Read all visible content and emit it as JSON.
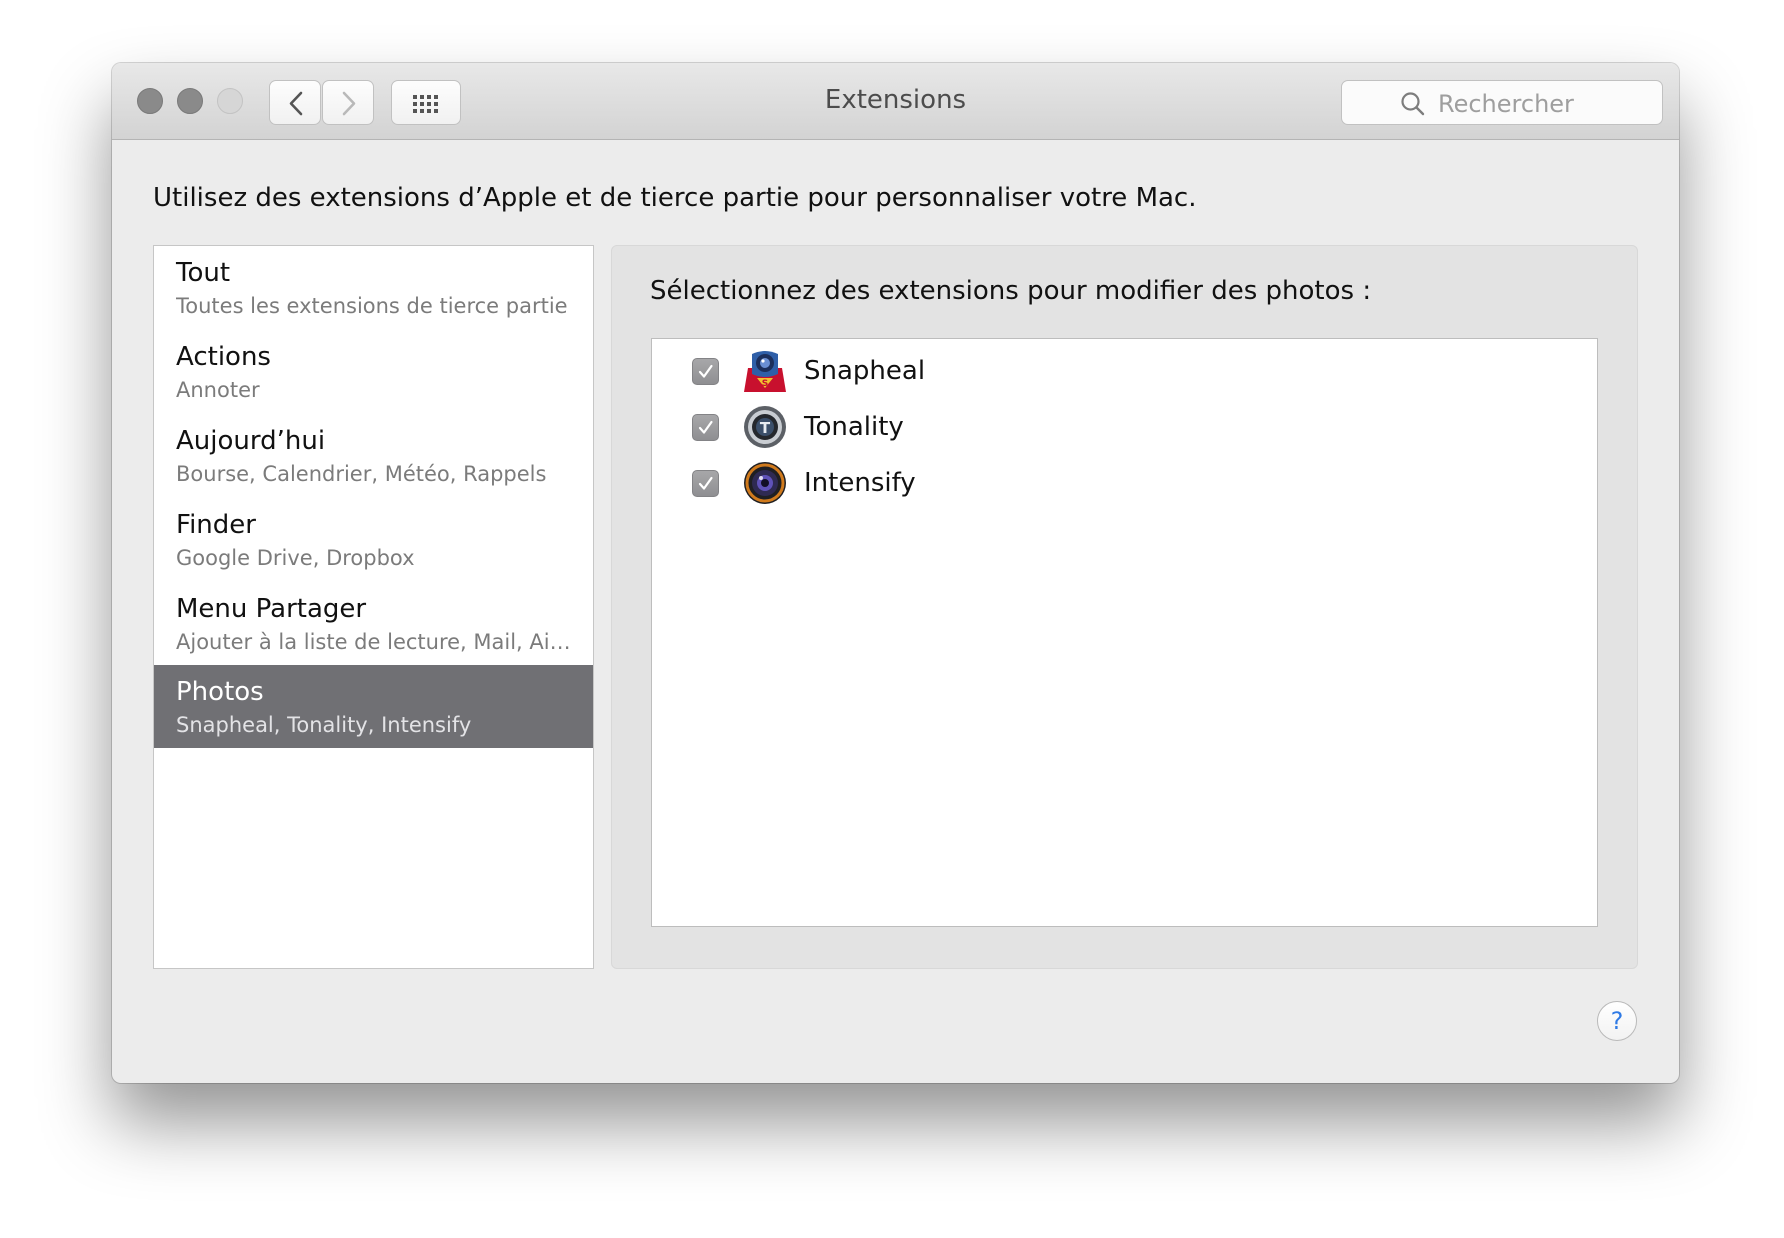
{
  "window": {
    "title": "Extensions",
    "search_placeholder": "Rechercher",
    "nav": {
      "back_icon": "chevron-left-icon",
      "forward_icon": "chevron-right-icon",
      "grid_icon": "grid-icon"
    }
  },
  "intro_text": "Utilisez des extensions d’Apple et de tierce partie pour personnaliser votre Mac.",
  "sidebar": {
    "items": [
      {
        "name": "Tout",
        "description": "Toutes les extensions de tierce partie",
        "selected": false
      },
      {
        "name": "Actions",
        "description": "Annoter",
        "selected": false
      },
      {
        "name": "Aujourd’hui",
        "description": "Bourse, Calendrier, Météo, Rappels",
        "selected": false
      },
      {
        "name": "Finder",
        "description": "Google Drive, Dropbox",
        "selected": false
      },
      {
        "name": "Menu Partager",
        "description": "Ajouter à la liste de lecture, Mail, Air...",
        "selected": false
      },
      {
        "name": "Photos",
        "description": "Snapheal, Tonality, Intensify",
        "selected": true
      }
    ]
  },
  "detail": {
    "label": "Sélectionnez des extensions pour modifier des photos :",
    "extensions": [
      {
        "name": "Snapheal",
        "checked": true,
        "icon": "snapheal-icon"
      },
      {
        "name": "Tonality",
        "checked": true,
        "icon": "tonality-icon"
      },
      {
        "name": "Intensify",
        "checked": true,
        "icon": "intensify-icon"
      }
    ]
  },
  "help": {
    "label": "?"
  },
  "colors": {
    "selection": "#707074",
    "help_accent": "#2f7ae5",
    "window_bg": "#ececec"
  }
}
